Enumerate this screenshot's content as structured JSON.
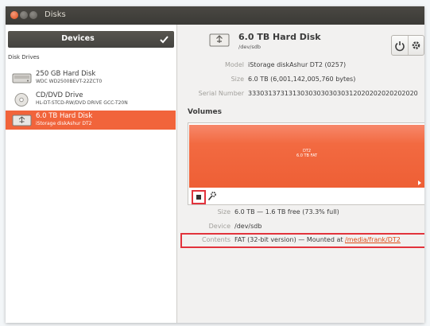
{
  "window": {
    "title": "Disks"
  },
  "sidebar": {
    "header": "Devices",
    "section_label": "Disk Drives",
    "items": [
      {
        "name": "250 GB Hard Disk",
        "sub": "WDC WD2500BEVT-22ZCT0",
        "icon": "hard-disk-icon"
      },
      {
        "name": "CD/DVD Drive",
        "sub": "HL-DT-STCD-RW/DVD DRIVE GCC-T20N",
        "icon": "optical-disc-icon"
      },
      {
        "name": "6.0 TB Hard Disk",
        "sub": "iStorage diskAshur DT2",
        "icon": "usb-disk-icon",
        "selected": true
      }
    ]
  },
  "disk": {
    "title": "6.0 TB Hard Disk",
    "device": "/dev/sdb",
    "info": [
      {
        "key": "Model",
        "value": "iStorage diskAshur DT2 (0257)"
      },
      {
        "key": "Size",
        "value": "6.0 TB (6,001,142,005,760 bytes)"
      },
      {
        "key": "Serial Number",
        "value": "333031373131303030303030312020202020202020"
      }
    ]
  },
  "volumes": {
    "label": "Volumes",
    "partition": {
      "name": "DT2",
      "size": "6.0 TB FAT"
    },
    "details": [
      {
        "key": "Size",
        "value": "6.0 TB — 1.6 TB free (73.3% full)"
      },
      {
        "key": "Device",
        "value": "/dev/sdb"
      }
    ],
    "contents": {
      "key": "Contents",
      "prefix": "FAT (32-bit version) — Mounted at ",
      "link": "/media/frank/DT2"
    }
  },
  "colors": {
    "accent": "#f1643b",
    "highlight": "#e2333c",
    "titlebar": "#3b3a36"
  }
}
